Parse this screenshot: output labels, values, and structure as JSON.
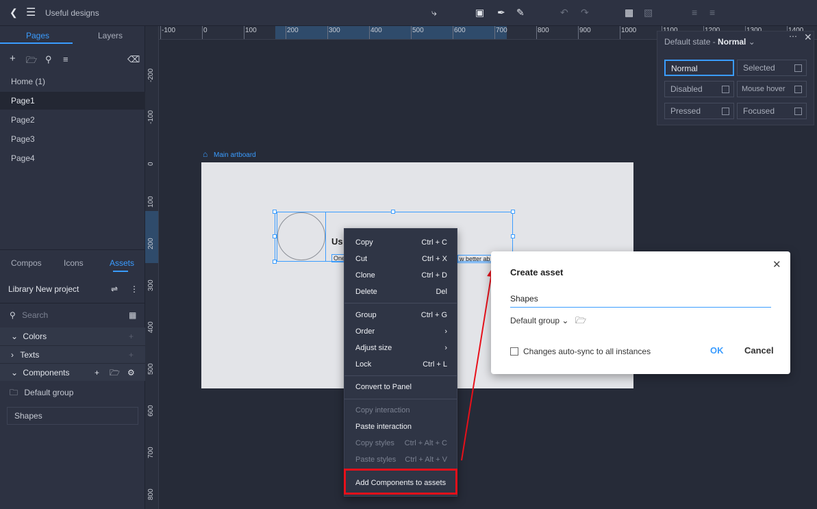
{
  "topbar": {
    "title": "Useful designs",
    "icons": [
      "back-icon",
      "menu-icon",
      "connector-icon",
      "artboard-add-icon",
      "pen-icon",
      "pencil-icon",
      "undo-icon",
      "redo-icon",
      "frame-icon",
      "frame-alt-icon",
      "align-center-icon",
      "distribute-icon"
    ]
  },
  "left": {
    "tabs": {
      "pages": "Pages",
      "layers": "Layers"
    },
    "pages": [
      "Home (1)",
      "Page1",
      "Page2",
      "Page3",
      "Page4"
    ],
    "selected_page": "Page1",
    "lower_tabs": {
      "compos": "Compos",
      "icons": "Icons",
      "assets": "Assets"
    },
    "library": "Library New project",
    "search_placeholder": "Search",
    "sections": {
      "colors": "Colors",
      "texts": "Texts",
      "components": "Components"
    },
    "group": "Default group",
    "asset_item": "Shapes"
  },
  "rulers": {
    "top": [
      "-100",
      "0",
      "100",
      "200",
      "300",
      "400",
      "500",
      "600",
      "700",
      "800",
      "900",
      "1000",
      "1100",
      "1200",
      "1300",
      "1400"
    ],
    "left": [
      "-200",
      "-100",
      "0",
      "100",
      "200",
      "300",
      "400",
      "500",
      "600",
      "700",
      "800"
    ]
  },
  "canvas": {
    "artboard_label": "Main artboard",
    "text_frag_title": "Us",
    "text_frag_body": "One",
    "text_frag_body2": "w better ab"
  },
  "context_menu": {
    "items": [
      {
        "label": "Copy",
        "shortcut": "Ctrl + C"
      },
      {
        "label": "Cut",
        "shortcut": "Ctrl + X"
      },
      {
        "label": "Clone",
        "shortcut": "Ctrl + D"
      },
      {
        "label": "Delete",
        "shortcut": "Del"
      },
      {
        "label": "Group",
        "shortcut": "Ctrl + G"
      },
      {
        "label": "Order",
        "shortcut": ""
      },
      {
        "label": "Adjust size",
        "shortcut": ""
      },
      {
        "label": "Lock",
        "shortcut": "Ctrl + L"
      },
      {
        "label": "Convert to Panel",
        "shortcut": ""
      },
      {
        "label": "Copy interaction",
        "shortcut": ""
      },
      {
        "label": "Paste interaction",
        "shortcut": ""
      },
      {
        "label": "Copy styles",
        "shortcut": "Ctrl + Alt + C"
      },
      {
        "label": "Paste styles",
        "shortcut": "Ctrl + Alt + V"
      },
      {
        "label": "Add Components to assets",
        "shortcut": ""
      }
    ]
  },
  "state_panel": {
    "header_prefix": "Default state - ",
    "header_value": "Normal",
    "states": [
      "Normal",
      "Selected",
      "Disabled",
      "Mouse hover",
      "Pressed",
      "Focused"
    ],
    "active": "Normal"
  },
  "dialog": {
    "title": "Create asset",
    "name_value": "Shapes",
    "group": "Default group",
    "checkbox_label": "Changes auto-sync to all instances",
    "ok": "OK",
    "cancel": "Cancel"
  },
  "colors": {
    "accent": "#3a9cff",
    "annotation": "#e8101a"
  }
}
